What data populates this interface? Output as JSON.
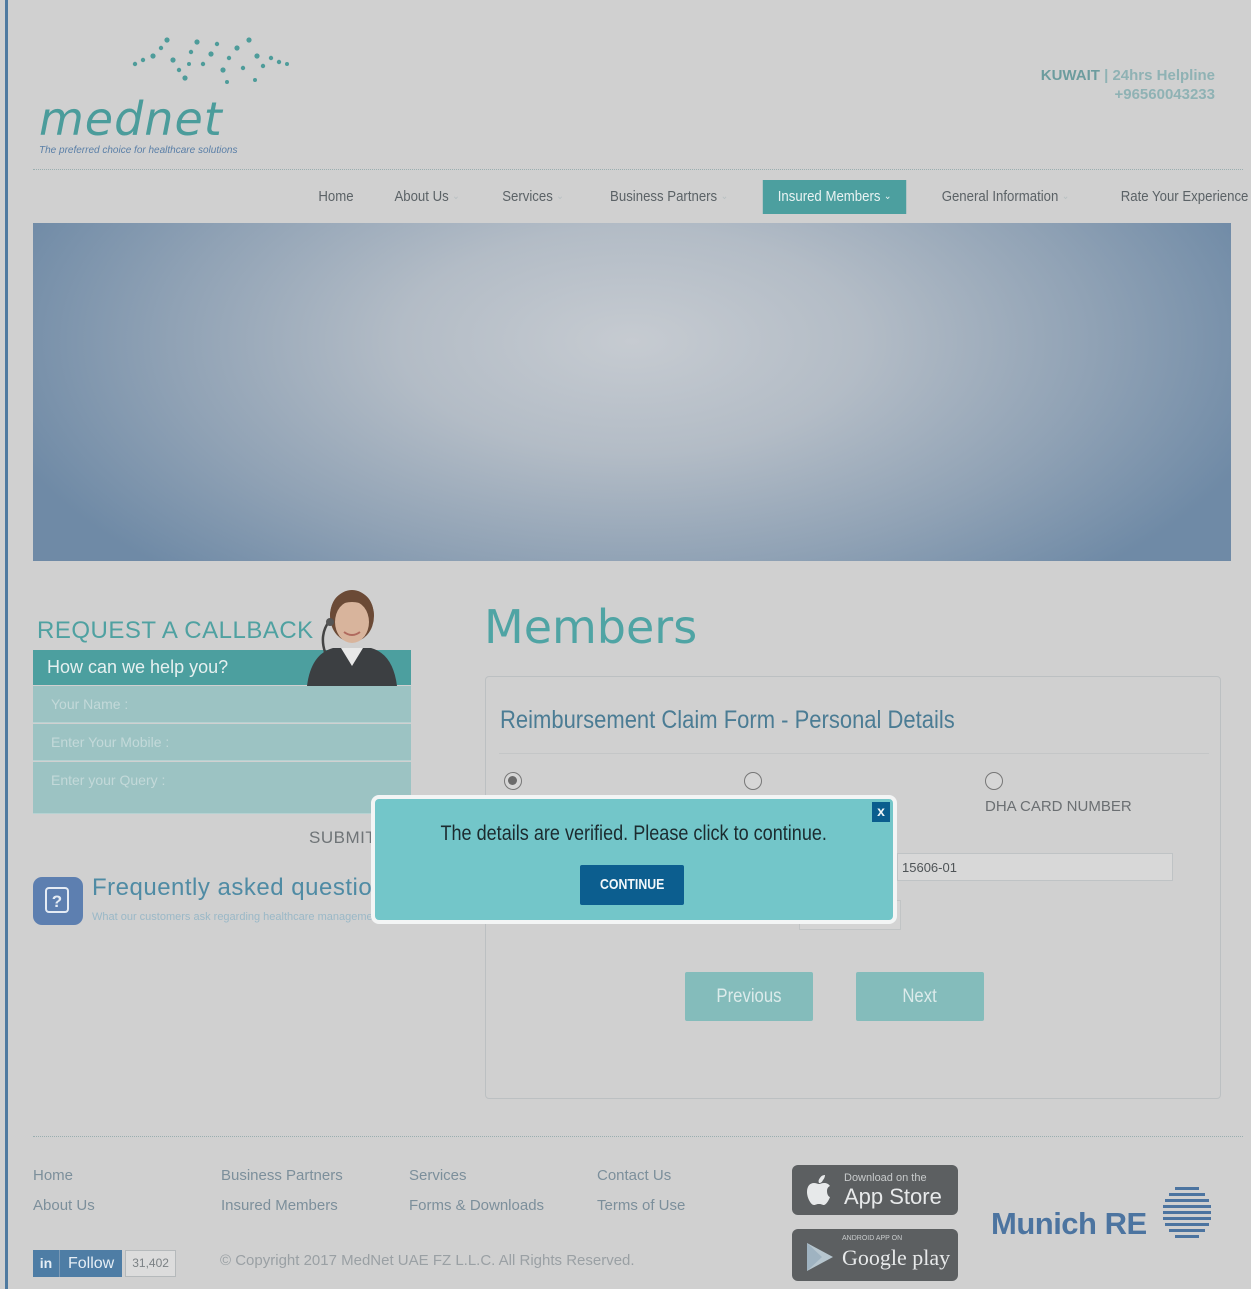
{
  "header": {
    "logo_text": "mednet",
    "tagline": "The preferred choice for healthcare solutions",
    "country": "KUWAIT",
    "helpline_label": " | 24hrs Helpline",
    "helpline_number": "+96560043233"
  },
  "nav": {
    "items": [
      {
        "label": "Home"
      },
      {
        "label": "About Us"
      },
      {
        "label": "Services"
      },
      {
        "label": "Business Partners"
      },
      {
        "label": "Insured Members"
      },
      {
        "label": "General Information"
      },
      {
        "label": "Rate Your Experience"
      }
    ],
    "active": "Insured Members"
  },
  "callback": {
    "title": "REQUEST A CALLBACK",
    "subtitle": "How can we help you?",
    "name_placeholder": "Your Name :",
    "mobile_placeholder": "Enter Your Mobile :",
    "query_placeholder": "Enter your Query :",
    "submit_label": "SUBMIT"
  },
  "faq": {
    "title": "Frequently asked questions",
    "subtitle": "What our customers ask regarding healthcare management"
  },
  "members": {
    "title": "Members",
    "form_title": "Reimbursement Claim Form - Personal Details",
    "radio_third_label": "DHA CARD NUMBER",
    "card_input_value": "15606-01",
    "previous_label": "Previous",
    "next_label": "Next"
  },
  "modal": {
    "close_label": "x",
    "message": "The details are verified. Please click to continue.",
    "continue_label": "CONTINUE"
  },
  "footer": {
    "links_col1": [
      "Home",
      "About Us"
    ],
    "links_col2": [
      "Business Partners",
      "Insured Members"
    ],
    "links_col3": [
      "Services",
      "Forms & Downloads"
    ],
    "links_col4": [
      "Contact Us",
      "Terms of Use"
    ],
    "copyright": "© Copyright 2017 MedNet UAE FZ L.L.C. All Rights Reserved.",
    "linkedin_in": "in",
    "linkedin_follow": "Follow",
    "linkedin_count": "31,402",
    "appstore_small": "Download on the",
    "appstore_big": "App Store",
    "googleplay_small": "ANDROID APP ON",
    "googleplay_big": "Google play",
    "partner": "Munich RE"
  },
  "colors": {
    "brand_teal": "#4c9f9f",
    "nav_active": "#4c9f9f",
    "modal_bg": "#73c6c9",
    "modal_button": "#0c5e8f"
  }
}
